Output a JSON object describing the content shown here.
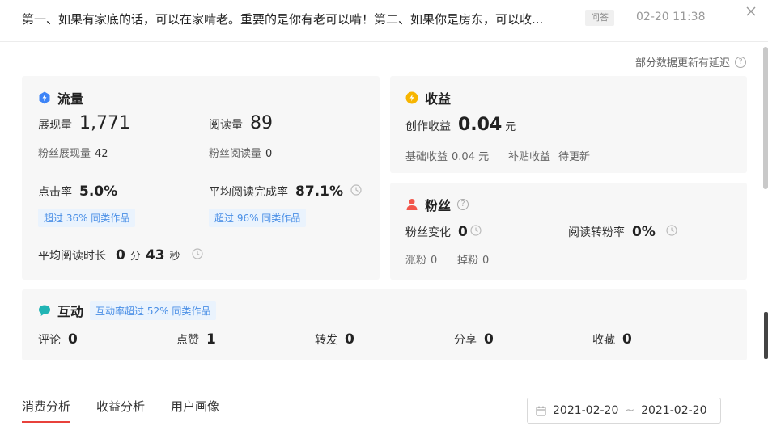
{
  "header": {
    "title": "第一、如果有家底的话，可以在家啃老。重要的是你有老可以啃！第二、如果你是房东，可以收...",
    "tag": "问答",
    "time": "02-20 11:38"
  },
  "delay_note": "部分数据更新有延迟",
  "flow": {
    "title": "流量",
    "impressions_label": "展现量",
    "impressions_value": "1,771",
    "reads_label": "阅读量",
    "reads_value": "89",
    "fan_impressions_label": "粉丝展现量",
    "fan_impressions_value": "42",
    "fan_reads_label": "粉丝阅读量",
    "fan_reads_value": "0",
    "ctr_label": "点击率",
    "ctr_value": "5.0%",
    "ctr_badge": "超过 36% 同类作品",
    "completion_label": "平均阅读完成率",
    "completion_value": "87.1%",
    "completion_badge": "超过 96% 同类作品",
    "avg_time_label": "平均阅读时长",
    "avg_time_min": "0",
    "avg_time_min_unit": "分",
    "avg_time_sec": "43",
    "avg_time_sec_unit": "秒"
  },
  "income": {
    "title": "收益",
    "creation_label": "创作收益",
    "creation_value": "0.04",
    "creation_unit": "元",
    "base_label": "基础收益",
    "base_value": "0.04 元",
    "subsidy_label": "补贴收益",
    "subsidy_value": "待更新"
  },
  "fans": {
    "title": "粉丝",
    "change_label": "粉丝变化",
    "change_value": "0",
    "conversion_label": "阅读转粉率",
    "conversion_value": "0%",
    "gain_label": "涨粉",
    "gain_value": "0",
    "loss_label": "掉粉",
    "loss_value": "0"
  },
  "interact": {
    "title": "互动",
    "badge": "互动率超过 52% 同类作品",
    "items": [
      {
        "label": "评论",
        "value": "0"
      },
      {
        "label": "点赞",
        "value": "1"
      },
      {
        "label": "转发",
        "value": "0"
      },
      {
        "label": "分享",
        "value": "0"
      },
      {
        "label": "收藏",
        "value": "0"
      }
    ]
  },
  "tabs": [
    {
      "label": "消费分析",
      "active": true
    },
    {
      "label": "收益分析",
      "active": false
    },
    {
      "label": "用户画像",
      "active": false
    }
  ],
  "date_range": {
    "start": "2021-02-20",
    "separator": "~",
    "end": "2021-02-20"
  },
  "colors": {
    "flow_icon": "#3d84f7",
    "income_icon": "#f7b500",
    "fans_icon": "#f2564b",
    "interact_icon": "#21b5b5",
    "accent_red": "#e8413b",
    "badge_blue": "#4a8fe6"
  },
  "icons": {
    "flow": "lightning-icon",
    "income": "coin-icon",
    "fans": "person-icon",
    "interact": "chat-bubble-icon",
    "timer": "clock-icon",
    "close": "close-icon",
    "calendar": "calendar-icon"
  }
}
